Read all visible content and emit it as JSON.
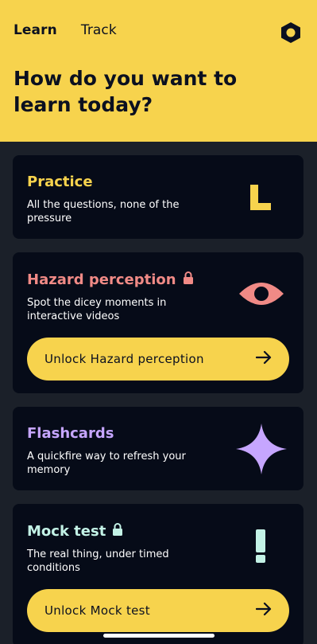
{
  "header": {
    "tabs": [
      {
        "label": "Learn",
        "active": true
      },
      {
        "label": "Track",
        "active": false
      }
    ],
    "settings_icon": "hexagon-settings-icon",
    "title": "How do you want to learn today?"
  },
  "cards": {
    "practice": {
      "title": "Practice",
      "title_color": "#f7d34d",
      "description": "All the questions, none of the pressure",
      "art_icon": "L-shape-icon",
      "locked": false
    },
    "hazard": {
      "title": "Hazard perception",
      "title_color": "#f08a86",
      "description": "Spot the dicey moments in interactive videos",
      "art_icon": "eye-icon",
      "locked": true,
      "button_label": "Unlock Hazard perception"
    },
    "flashcards": {
      "title": "Flashcards",
      "title_color": "#c6a6ff",
      "description": "A quickfire way to refresh your memory",
      "art_icon": "sparkle-star-icon",
      "locked": false
    },
    "mock": {
      "title": "Mock test",
      "title_color": "#c3f2e6",
      "description": "The real thing, under timed conditions",
      "art_icon": "exclamation-icon",
      "locked": true,
      "button_label": "Unlock Mock test"
    }
  },
  "colors": {
    "accent_yellow": "#f7d34d",
    "card_bg": "#060b18",
    "page_bg": "#1b2029"
  }
}
